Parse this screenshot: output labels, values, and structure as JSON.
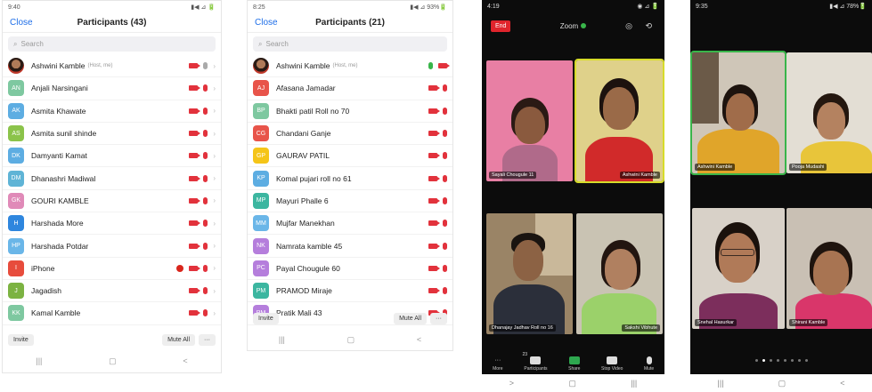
{
  "phone1": {
    "status_time": "9:40",
    "status_right": "▮◀ ⊿ 🔋",
    "close_label": "Close",
    "title": "Participants (43)",
    "search_placeholder": "Search",
    "participants": [
      {
        "initials": "",
        "name": "Ashwini Kamble",
        "host": "(Host, me)",
        "color": "#c0392b",
        "photo": true,
        "mic": "red",
        "hand": false
      },
      {
        "initials": "AN",
        "name": "Anjali Narsingani",
        "host": "",
        "color": "#7ec8a0",
        "mic": "red",
        "hand": false
      },
      {
        "initials": "AK",
        "name": "Asmita Khawate",
        "host": "",
        "color": "#5dade2",
        "mic": "red",
        "hand": false
      },
      {
        "initials": "AS",
        "name": "Asmita sunil shinde",
        "host": "",
        "color": "#8bc34a",
        "mic": "red",
        "hand": false
      },
      {
        "initials": "DK",
        "name": "Damyanti Kamat",
        "host": "",
        "color": "#5dade2",
        "mic": "red",
        "hand": false
      },
      {
        "initials": "DM",
        "name": "Dhanashri Madiwal",
        "host": "",
        "color": "#5fb4d6",
        "mic": "red",
        "hand": false
      },
      {
        "initials": "GK",
        "name": "GOURI KAMBLE",
        "host": "",
        "color": "#e08ab8",
        "mic": "red",
        "hand": false
      },
      {
        "initials": "H",
        "name": "Harshada More",
        "host": "",
        "color": "#2e86de",
        "mic": "red",
        "hand": false
      },
      {
        "initials": "HP",
        "name": "Harshada Potdar",
        "host": "",
        "color": "#6ab6e8",
        "mic": "red",
        "hand": false
      },
      {
        "initials": "I",
        "name": "iPhone",
        "host": "",
        "color": "#e74c3c",
        "mic": "red",
        "hand": true
      },
      {
        "initials": "J",
        "name": "Jagadish",
        "host": "",
        "color": "#7cb342",
        "mic": "red",
        "hand": false
      },
      {
        "initials": "KK",
        "name": "Kamal Kamble",
        "host": "",
        "color": "#7ec8a0",
        "mic": "red",
        "hand": false
      }
    ],
    "invite_label": "Invite",
    "muteall_label": "Mute All",
    "more_label": "···",
    "nav": [
      "|||",
      "▢",
      "<"
    ]
  },
  "phone2": {
    "status_time": "8:25",
    "status_right": "▮◀ ⊿ 93%🔋",
    "close_label": "Close",
    "title": "Participants (21)",
    "search_placeholder": "Search",
    "participants": [
      {
        "initials": "",
        "name": "Ashwini Kamble",
        "host": "(Host, me)",
        "color": "#c0392b",
        "photo": true,
        "mic": "green"
      },
      {
        "initials": "AJ",
        "name": "Afasana Jamadar",
        "host": "",
        "color": "#e8544a",
        "mic": "red"
      },
      {
        "initials": "BP",
        "name": "Bhakti patil Roll no 70",
        "host": "",
        "color": "#7ec8a0",
        "mic": "red"
      },
      {
        "initials": "CG",
        "name": "Chandani Ganje",
        "host": "",
        "color": "#e8544a",
        "mic": "red"
      },
      {
        "initials": "GP",
        "name": "GAURAV PATIL",
        "host": "",
        "color": "#f5c518",
        "mic": "red"
      },
      {
        "initials": "KP",
        "name": "Komal pujari roll no 61",
        "host": "",
        "color": "#5dade2",
        "mic": "red"
      },
      {
        "initials": "MP",
        "name": "Mayuri Phalle 6",
        "host": "",
        "color": "#3cb6a0",
        "mic": "red"
      },
      {
        "initials": "MM",
        "name": "Mujfar Manekhan",
        "host": "",
        "color": "#6ab6e8",
        "mic": "red"
      },
      {
        "initials": "NK",
        "name": "Namrata kamble 45",
        "host": "",
        "color": "#b57edc",
        "mic": "red"
      },
      {
        "initials": "PC",
        "name": "Payal Chougule 60",
        "host": "",
        "color": "#b57edc",
        "mic": "red"
      },
      {
        "initials": "PM",
        "name": "PRAMOD Miraje",
        "host": "",
        "color": "#3cb6a0",
        "mic": "red"
      },
      {
        "initials": "PM",
        "name": "Pratik Mali 43",
        "host": "",
        "color": "#b57edc",
        "mic": "red"
      }
    ],
    "invite_label": "Invite",
    "muteall_label": "Mute All",
    "more_label": "···",
    "nav": [
      "|||",
      "▢",
      "<"
    ]
  },
  "phone3": {
    "status_time": "4:19",
    "status_right": "◉ ⊿ 🔋",
    "leave_label": "End",
    "zoom_label": "Zoom",
    "top_icons": "◎ ⟲",
    "tiles": [
      {
        "name": "Sayali Chougule 11"
      },
      {
        "name": "Ashwini Kamble"
      },
      {
        "name": "Dhanajay Jadhav Roll no 16"
      },
      {
        "name": "Sakshi Vibhute"
      }
    ],
    "toolbar": [
      {
        "label": "More",
        "icon": "more-icon"
      },
      {
        "label": "Participants",
        "icon": "participants-icon",
        "badge": "23"
      },
      {
        "label": "Share",
        "icon": "share-icon"
      },
      {
        "label": "Stop Video",
        "icon": "video-icon"
      },
      {
        "label": "Mute",
        "icon": "mic-icon"
      }
    ],
    "nav": [
      ">",
      "▢",
      "|||"
    ]
  },
  "phone4": {
    "status_time": "9:35",
    "status_right": "▮◀ ⊿ 78%🔋",
    "tiles": [
      {
        "name": "Ashwini Kamble"
      },
      {
        "name": "Pooja Mudashi"
      },
      {
        "name": "Snehal Hasurkar"
      },
      {
        "name": "Shirani Kamble"
      }
    ],
    "pages": 8,
    "active_page": 1,
    "nav": [
      "|||",
      "▢",
      "<"
    ]
  }
}
